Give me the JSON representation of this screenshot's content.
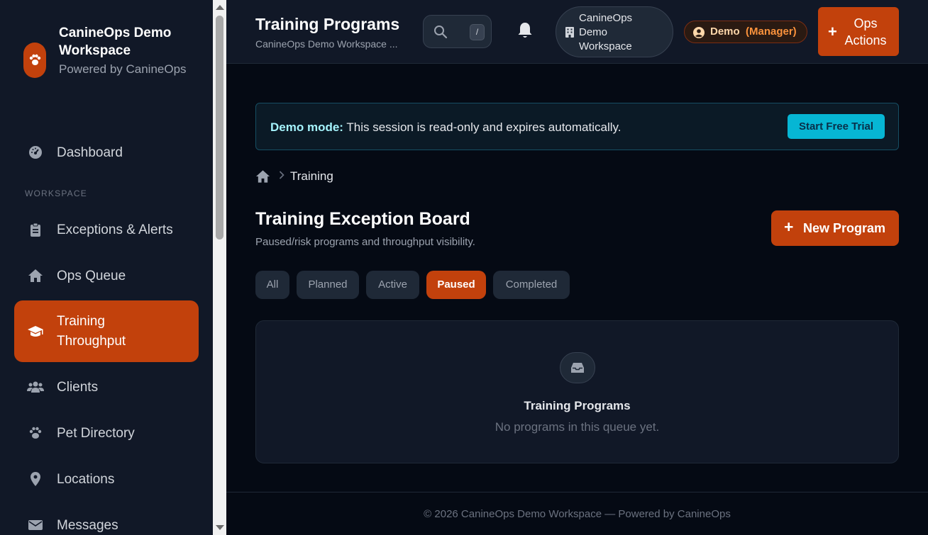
{
  "brand": {
    "title": "CanineOps Demo Workspace",
    "subtitle": "Powered by CanineOps"
  },
  "sidebar": {
    "section_label": "WORKSPACE",
    "items": [
      {
        "label": "Dashboard",
        "icon": "gauge-icon"
      },
      {
        "label": "Exceptions & Alerts",
        "icon": "clipboard-icon"
      },
      {
        "label": "Ops Queue",
        "icon": "home-icon"
      },
      {
        "label": "Training Throughput",
        "icon": "graduation-cap-icon",
        "active": true
      },
      {
        "label": "Clients",
        "icon": "users-icon"
      },
      {
        "label": "Pet Directory",
        "icon": "paw-icon"
      },
      {
        "label": "Locations",
        "icon": "map-pin-icon"
      },
      {
        "label": "Messages",
        "icon": "envelope-icon"
      }
    ]
  },
  "header": {
    "title": "Training Programs",
    "subtitle": "CanineOps Demo Workspace ...",
    "search_shortcut": "/",
    "workspace_label": "CanineOps Demo Workspace",
    "role_name": "Demo",
    "role_level": "(Manager)",
    "ops_label": "Ops Actions"
  },
  "banner": {
    "strong": "Demo mode:",
    "text": " This session is read-only and expires automatically.",
    "button": "Start Free Trial"
  },
  "breadcrumb": {
    "current": "Training"
  },
  "board": {
    "title": "Training Exception Board",
    "subtitle": "Paused/risk programs and throughput visibility.",
    "new_button": "New Program"
  },
  "filters": [
    {
      "label": "All"
    },
    {
      "label": "Planned"
    },
    {
      "label": "Active"
    },
    {
      "label": "Paused",
      "active": true
    },
    {
      "label": "Completed"
    }
  ],
  "empty_state": {
    "title": "Training Programs",
    "text": "No programs in this queue yet."
  },
  "footer": {
    "text": "© 2026 CanineOps Demo Workspace — Powered by CanineOps"
  },
  "colors": {
    "accent": "#c2410c",
    "banner_button": "#06b6d4",
    "background": "#050a14",
    "panel": "#111827"
  }
}
